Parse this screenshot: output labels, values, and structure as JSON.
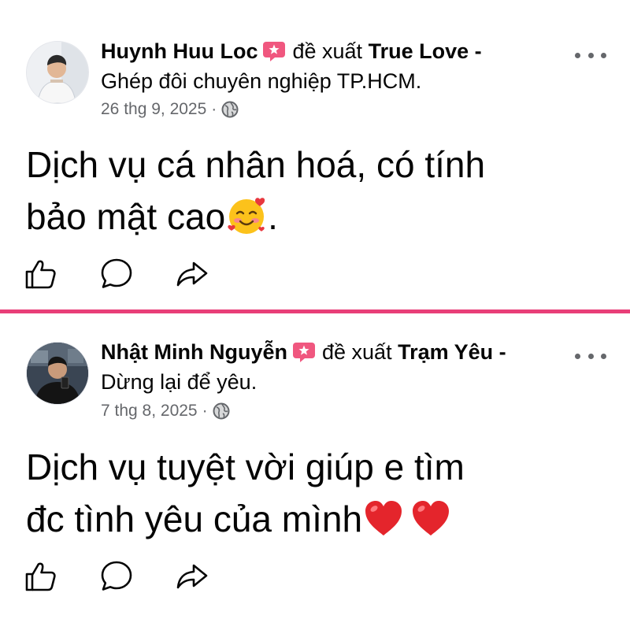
{
  "posts": [
    {
      "author": "Huynh Huu Loc",
      "recommends_text": "đề xuất",
      "page_name_bold": "True Love -",
      "page_name_cont": "Ghép đôi chuyên nghiệp TP.HCM.",
      "date": "26 thg 9, 2025",
      "separator": "·",
      "body_line1": "Dịch vụ cá nhân hoá, có tính",
      "body_line2": "bảo mật cao",
      "body_tail": ".",
      "emoji": "smiling-face-with-hearts"
    },
    {
      "author": "Nhật Minh Nguyễn",
      "recommends_text": "đề xuất",
      "page_name_bold": "Trạm Yêu -",
      "page_name_cont": "Dừng lại để yêu.",
      "date": "7 thg 8, 2025",
      "separator": "·",
      "body_line1": "Dịch vụ tuyệt vời giúp e tìm",
      "body_line2": "đc tình yêu của mình",
      "emoji": "red-heart"
    }
  ],
  "colors": {
    "divider": "#e83e78",
    "recommend_badge": "#f0577f",
    "meta_text": "#65676b"
  }
}
